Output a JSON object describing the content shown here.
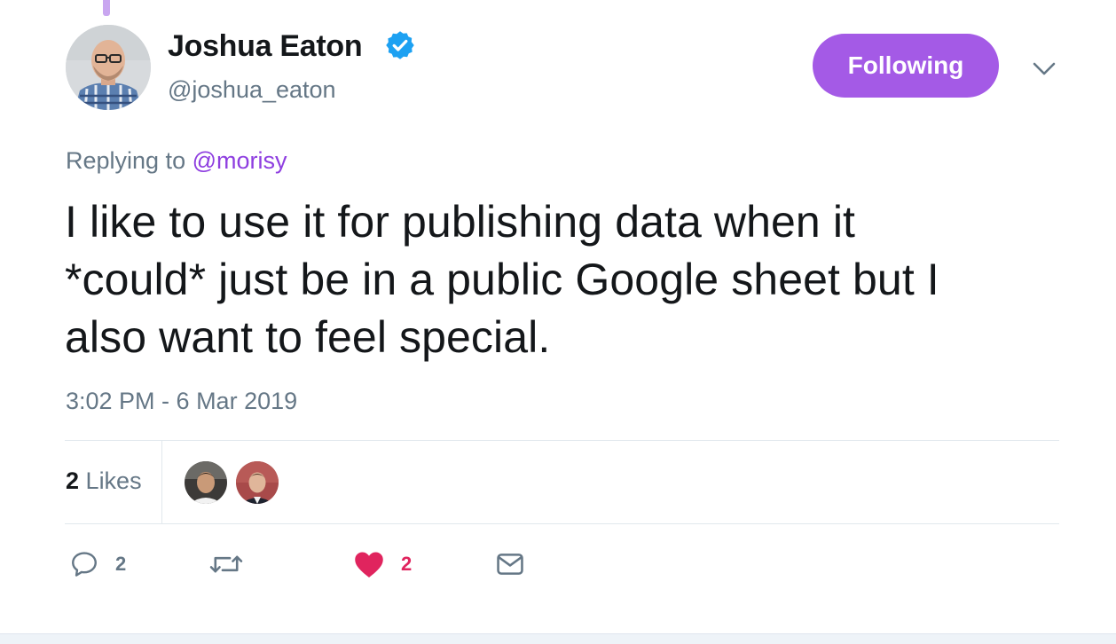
{
  "tweet": {
    "author": {
      "name": "Joshua Eaton",
      "handle": "@joshua_eaton",
      "verified": true
    },
    "follow_button_label": "Following",
    "replying_prefix": "Replying to",
    "replying_to": "@morisy",
    "text_lines": [
      "I like to use it for publishing data when it",
      "*could* just be in a public Google sheet but I",
      "also want to feel special."
    ],
    "timestamp": "3:02 PM - 6 Mar 2019"
  },
  "stats": {
    "likes_count": "2",
    "likes_label": "Likes",
    "likers": [
      "liker-avatar-1",
      "liker-avatar-2"
    ]
  },
  "actions": {
    "reply_count": "2",
    "retweet_count": "",
    "like_count": "2",
    "icons": [
      "reply-icon",
      "retweet-icon",
      "heart-icon",
      "message-icon"
    ]
  },
  "colors": {
    "accent": "#a45ae6",
    "mention": "#8e3ee0",
    "verified": "#1da1f2",
    "like": "#e0245e",
    "muted": "#657786"
  }
}
